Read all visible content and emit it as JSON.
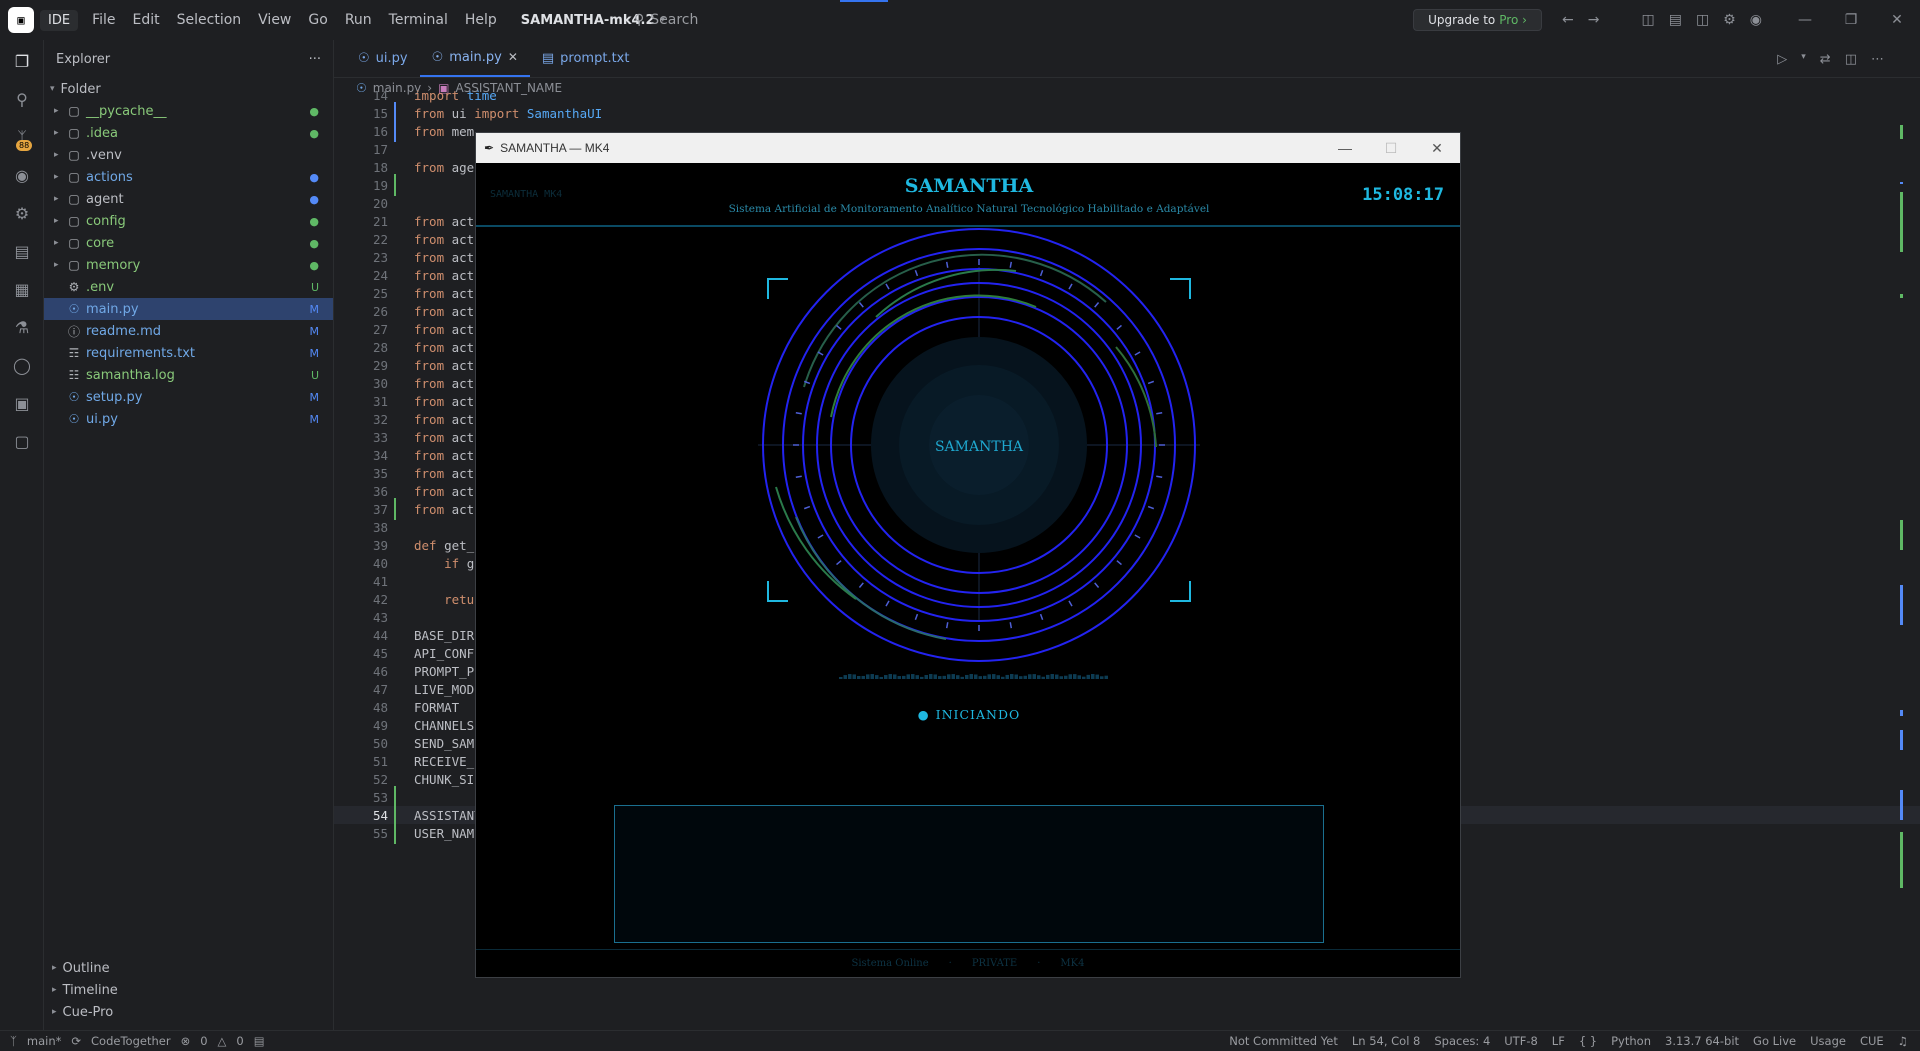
{
  "titlebar": {
    "logo": "IDE",
    "ide_label": "IDE",
    "menu": [
      "File",
      "Edit",
      "Selection",
      "View",
      "Go",
      "Run",
      "Terminal",
      "Help"
    ],
    "project": "SAMANTHA-mk4.2",
    "search_placeholder": "Search",
    "upgrade_text": "Upgrade to",
    "upgrade_pro": "Pro ›"
  },
  "activity": {
    "badge": "88"
  },
  "explorer": {
    "title": "Explorer",
    "more": "···",
    "root": "Folder",
    "items": [
      {
        "name": "__pycache__",
        "type": "folder",
        "color": "green",
        "status": "●",
        "status_color": "green"
      },
      {
        "name": ".idea",
        "type": "folder",
        "color": "green",
        "status": "●",
        "status_color": "green"
      },
      {
        "name": ".venv",
        "type": "folder",
        "color": "plain",
        "status": "",
        "status_color": ""
      },
      {
        "name": "actions",
        "type": "folder",
        "color": "blue",
        "status": "●",
        "status_color": "blue"
      },
      {
        "name": "agent",
        "type": "folder",
        "color": "plain",
        "status": "●",
        "status_color": "blue"
      },
      {
        "name": "config",
        "type": "folder",
        "color": "green",
        "status": "●",
        "status_color": "green"
      },
      {
        "name": "core",
        "type": "folder",
        "color": "green",
        "status": "●",
        "status_color": "green"
      },
      {
        "name": "memory",
        "type": "folder",
        "color": "green",
        "status": "●",
        "status_color": "green"
      },
      {
        "name": ".env",
        "type": "env",
        "color": "green",
        "status": "U",
        "status_color": "green"
      },
      {
        "name": "main.py",
        "type": "py",
        "color": "blue",
        "status": "M",
        "status_color": "blue"
      },
      {
        "name": "readme.md",
        "type": "md",
        "color": "blue",
        "status": "M",
        "status_color": "blue"
      },
      {
        "name": "requirements.txt",
        "type": "txt",
        "color": "blue",
        "status": "M",
        "status_color": "blue"
      },
      {
        "name": "samantha.log",
        "type": "log",
        "color": "green",
        "status": "U",
        "status_color": "green"
      },
      {
        "name": "setup.py",
        "type": "py",
        "color": "blue",
        "status": "M",
        "status_color": "blue"
      },
      {
        "name": "ui.py",
        "type": "py",
        "color": "blue",
        "status": "M",
        "status_color": "blue"
      }
    ],
    "bottom": [
      "Outline",
      "Timeline",
      "Cue-Pro"
    ]
  },
  "editor": {
    "tabs": [
      {
        "label": "ui.py",
        "active": false
      },
      {
        "label": "main.py",
        "active": true
      },
      {
        "label": "prompt.txt",
        "active": false
      }
    ],
    "breadcrumb": [
      "main.py",
      "ASSISTANT_NAME"
    ],
    "lines": [
      {
        "n": "14",
        "t": "import time"
      },
      {
        "n": "15",
        "t": "from ui import SamanthaUI"
      },
      {
        "n": "16",
        "t": "from mem"
      },
      {
        "n": "17",
        "t": ""
      },
      {
        "n": "18",
        "t": "from age"
      },
      {
        "n": "19",
        "t": ""
      },
      {
        "n": "20",
        "t": ""
      },
      {
        "n": "21",
        "t": "from act"
      },
      {
        "n": "22",
        "t": "from act"
      },
      {
        "n": "23",
        "t": "from act"
      },
      {
        "n": "24",
        "t": "from act"
      },
      {
        "n": "25",
        "t": "from act"
      },
      {
        "n": "26",
        "t": "from act"
      },
      {
        "n": "27",
        "t": "from act"
      },
      {
        "n": "28",
        "t": "from act"
      },
      {
        "n": "29",
        "t": "from act"
      },
      {
        "n": "30",
        "t": "from act"
      },
      {
        "n": "31",
        "t": "from act"
      },
      {
        "n": "32",
        "t": "from act"
      },
      {
        "n": "33",
        "t": "from act"
      },
      {
        "n": "34",
        "t": "from act"
      },
      {
        "n": "35",
        "t": "from act"
      },
      {
        "n": "36",
        "t": "from act"
      },
      {
        "n": "37",
        "t": "from act"
      },
      {
        "n": "38",
        "t": ""
      },
      {
        "n": "39",
        "t": "def get_"
      },
      {
        "n": "40",
        "t": "    if g"
      },
      {
        "n": "41",
        "t": ""
      },
      {
        "n": "42",
        "t": "    retu"
      },
      {
        "n": "43",
        "t": ""
      },
      {
        "n": "44",
        "t": "BASE_DIR"
      },
      {
        "n": "45",
        "t": "API_CONF"
      },
      {
        "n": "46",
        "t": "PROMPT_P"
      },
      {
        "n": "47",
        "t": "LIVE_MOD"
      },
      {
        "n": "48",
        "t": "FORMAT"
      },
      {
        "n": "49",
        "t": "CHANNELS"
      },
      {
        "n": "50",
        "t": "SEND_SAM"
      },
      {
        "n": "51",
        "t": "RECEIVE_"
      },
      {
        "n": "52",
        "t": "CHUNK_SI"
      },
      {
        "n": "53",
        "t": ""
      },
      {
        "n": "54",
        "t": "ASSISTANT_NAME = os.environ.get(\"ASSISTANT_NAME\", \"Samantha\")"
      },
      {
        "n": "55",
        "t": "USER_NAME = os.environ.get(\"USER_NAME\") or os.environ.get(\"SAMANTHA_USER\") or getpass.getuser()"
      }
    ]
  },
  "samantha": {
    "window_title": "SAMANTHA — MK4",
    "small_label": "SAMANTHA MK4",
    "title": "SAMANTHA",
    "subtitle": "Sistema Artificial de Monitoramento Analítico Natural Tecnológico Habilitado e Adaptável",
    "clock": "15:08:17",
    "core_label": "SAMANTHA",
    "status": "INICIANDO",
    "footer": [
      "Sistema Online",
      "·",
      "PRIVATE",
      "·",
      "MK4"
    ]
  },
  "statusbar": {
    "branch": "main*",
    "collab": "CodeTogether",
    "errors": "0",
    "warnings": "0",
    "right": [
      "Not Committed Yet",
      "Ln 54, Col 8",
      "Spaces: 4",
      "UTF-8",
      "LF",
      "{ }",
      "Python",
      "3.13.7 64-bit",
      "Go Live",
      "Usage",
      "CUE"
    ]
  }
}
